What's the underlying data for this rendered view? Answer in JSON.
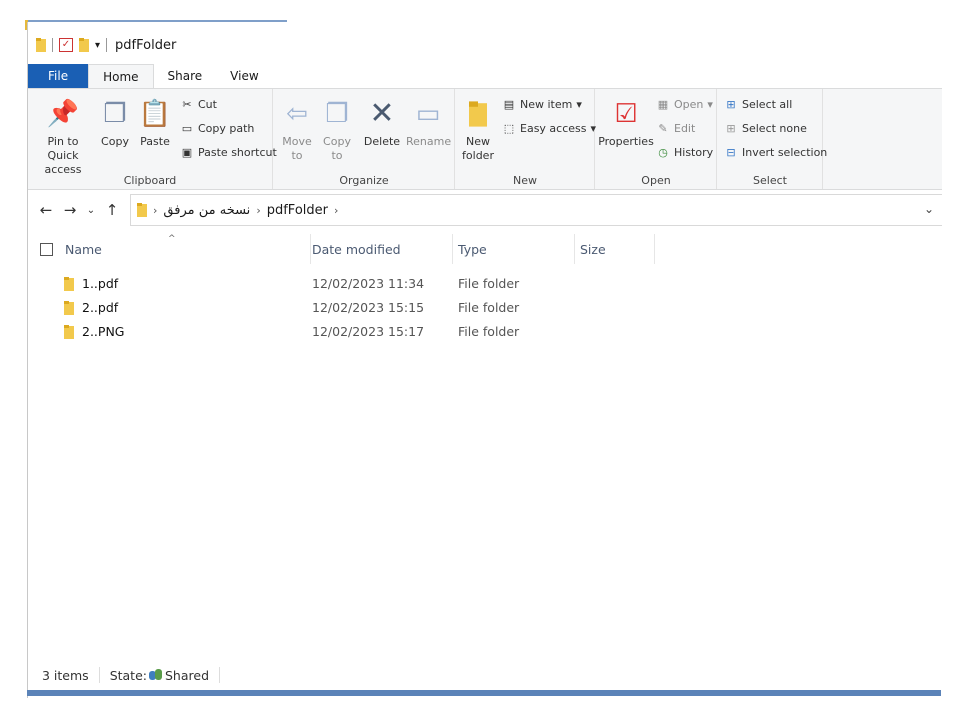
{
  "window": {
    "title": "pdfFolder"
  },
  "tabs": [
    {
      "label": "File"
    },
    {
      "label": "Home"
    },
    {
      "label": "Share"
    },
    {
      "label": "View"
    }
  ],
  "ribbon": {
    "clipboard": {
      "label": "Clipboard",
      "pin": "Pin to Quick access",
      "copy": "Copy",
      "paste": "Paste",
      "cut": "Cut",
      "copy_path": "Copy path",
      "paste_shortcut": "Paste shortcut"
    },
    "organize": {
      "label": "Organize",
      "move_to": "Move to",
      "copy_to": "Copy to",
      "delete": "Delete",
      "rename": "Rename"
    },
    "new": {
      "label": "New",
      "new_folder": "New folder",
      "new_item": "New item",
      "easy_access": "Easy access"
    },
    "open": {
      "label": "Open",
      "properties": "Properties",
      "open": "Open",
      "edit": "Edit",
      "history": "History"
    },
    "select": {
      "label": "Select",
      "select_all": "Select all",
      "select_none": "Select none",
      "invert": "Invert selection"
    }
  },
  "address": {
    "crumbs": [
      "نسخه من مرفق",
      "pdfFolder"
    ]
  },
  "columns": {
    "name": "Name",
    "date": "Date modified",
    "type": "Type",
    "size": "Size"
  },
  "files": [
    {
      "name": "1..pdf",
      "date": "12/02/2023 11:34",
      "type": "File folder"
    },
    {
      "name": "2..pdf",
      "date": "12/02/2023 15:15",
      "type": "File folder"
    },
    {
      "name": "2..PNG",
      "date": "12/02/2023 15:17",
      "type": "File folder"
    }
  ],
  "status": {
    "items": "3 items",
    "state_label": "State:",
    "state_value": "Shared"
  },
  "colors": {
    "file_tab": "#1a5fb4",
    "folder": "#f2c94c",
    "accent": "#5b83b8"
  }
}
